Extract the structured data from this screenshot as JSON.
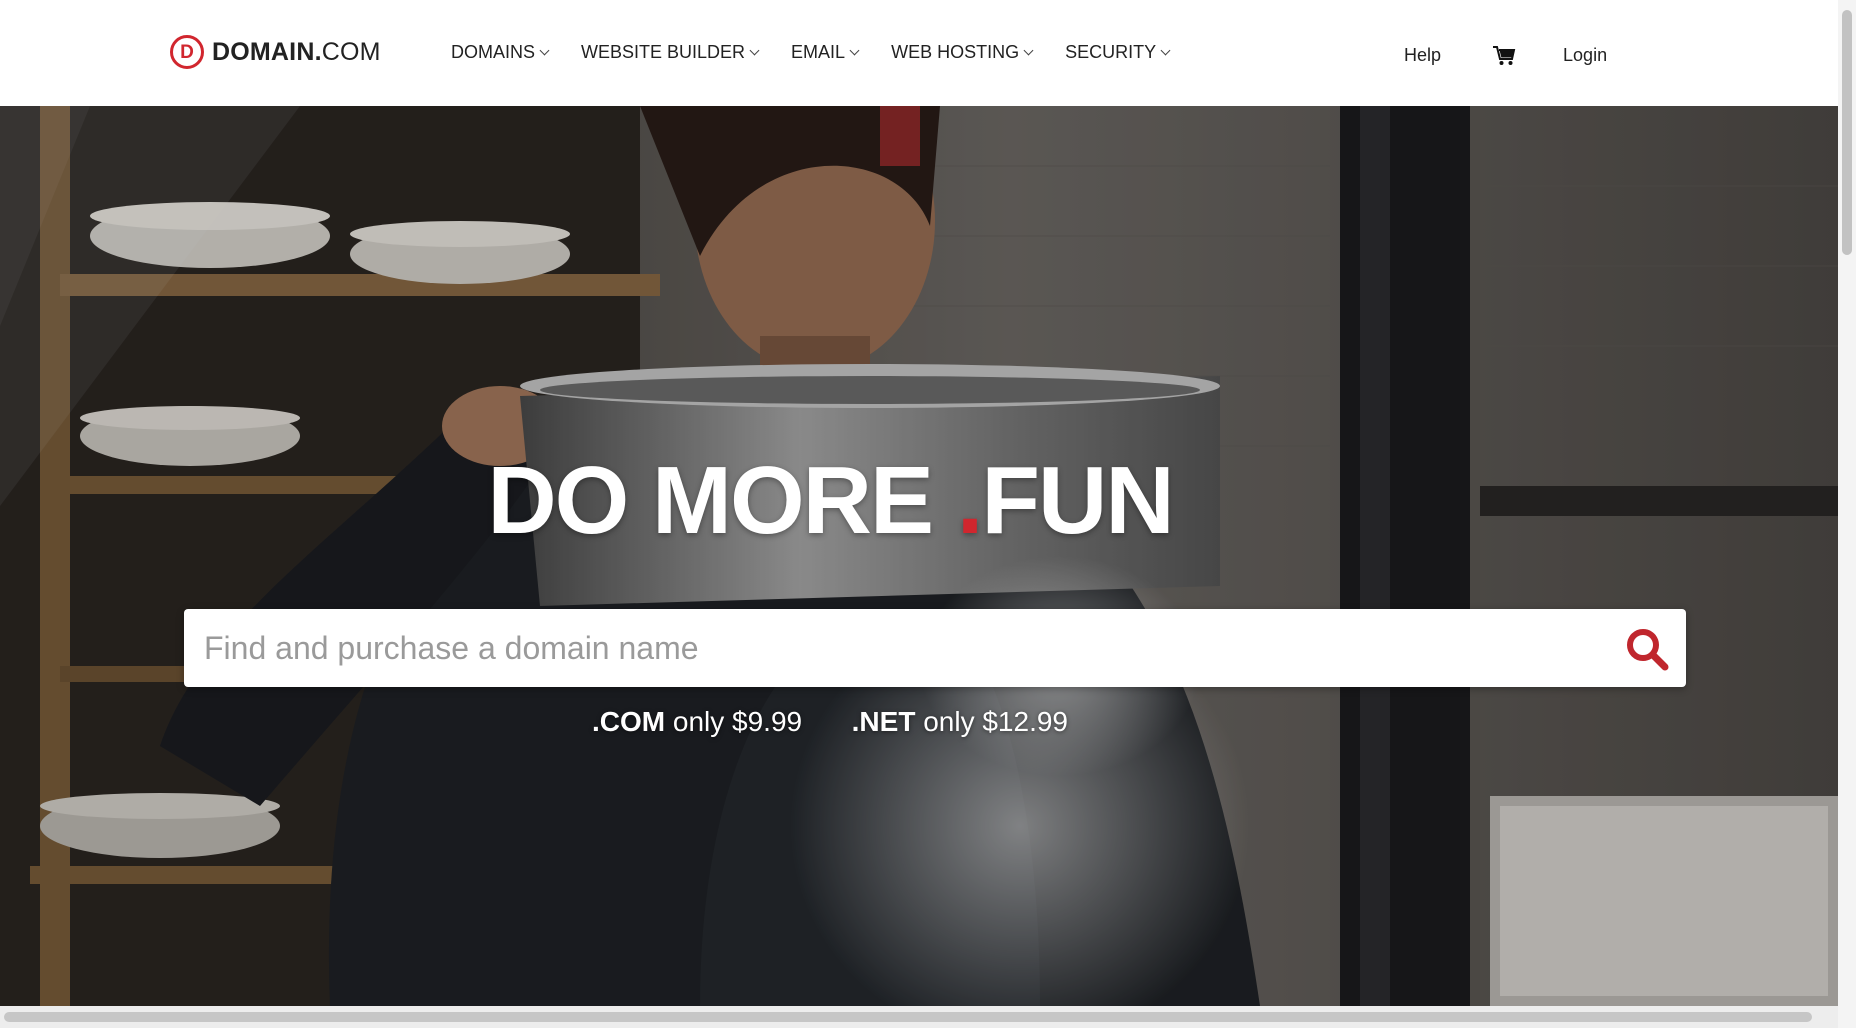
{
  "header": {
    "logo": {
      "mark": "D",
      "bold": "DOMAIN.",
      "light": "COM"
    },
    "nav": [
      {
        "label": "DOMAINS"
      },
      {
        "label": "WEBSITE BUILDER"
      },
      {
        "label": "EMAIL"
      },
      {
        "label": "WEB HOSTING"
      },
      {
        "label": "SECURITY"
      }
    ],
    "help_label": "Help",
    "cart_icon": "shopping-cart-icon",
    "login_label": "Login"
  },
  "hero": {
    "title_part1": "DO MORE",
    "title_dot": ".",
    "title_part2": "FUN",
    "search": {
      "placeholder": "Find and purchase a domain name",
      "value": "",
      "button_icon": "search-icon"
    },
    "prices": [
      {
        "tld": ".COM",
        "text": "only $9.99"
      },
      {
        "tld": ".NET",
        "text": "only $12.99"
      }
    ]
  },
  "colors": {
    "brand_red": "#d1262e",
    "text_dark": "#222222",
    "hero_text": "#ffffff"
  }
}
